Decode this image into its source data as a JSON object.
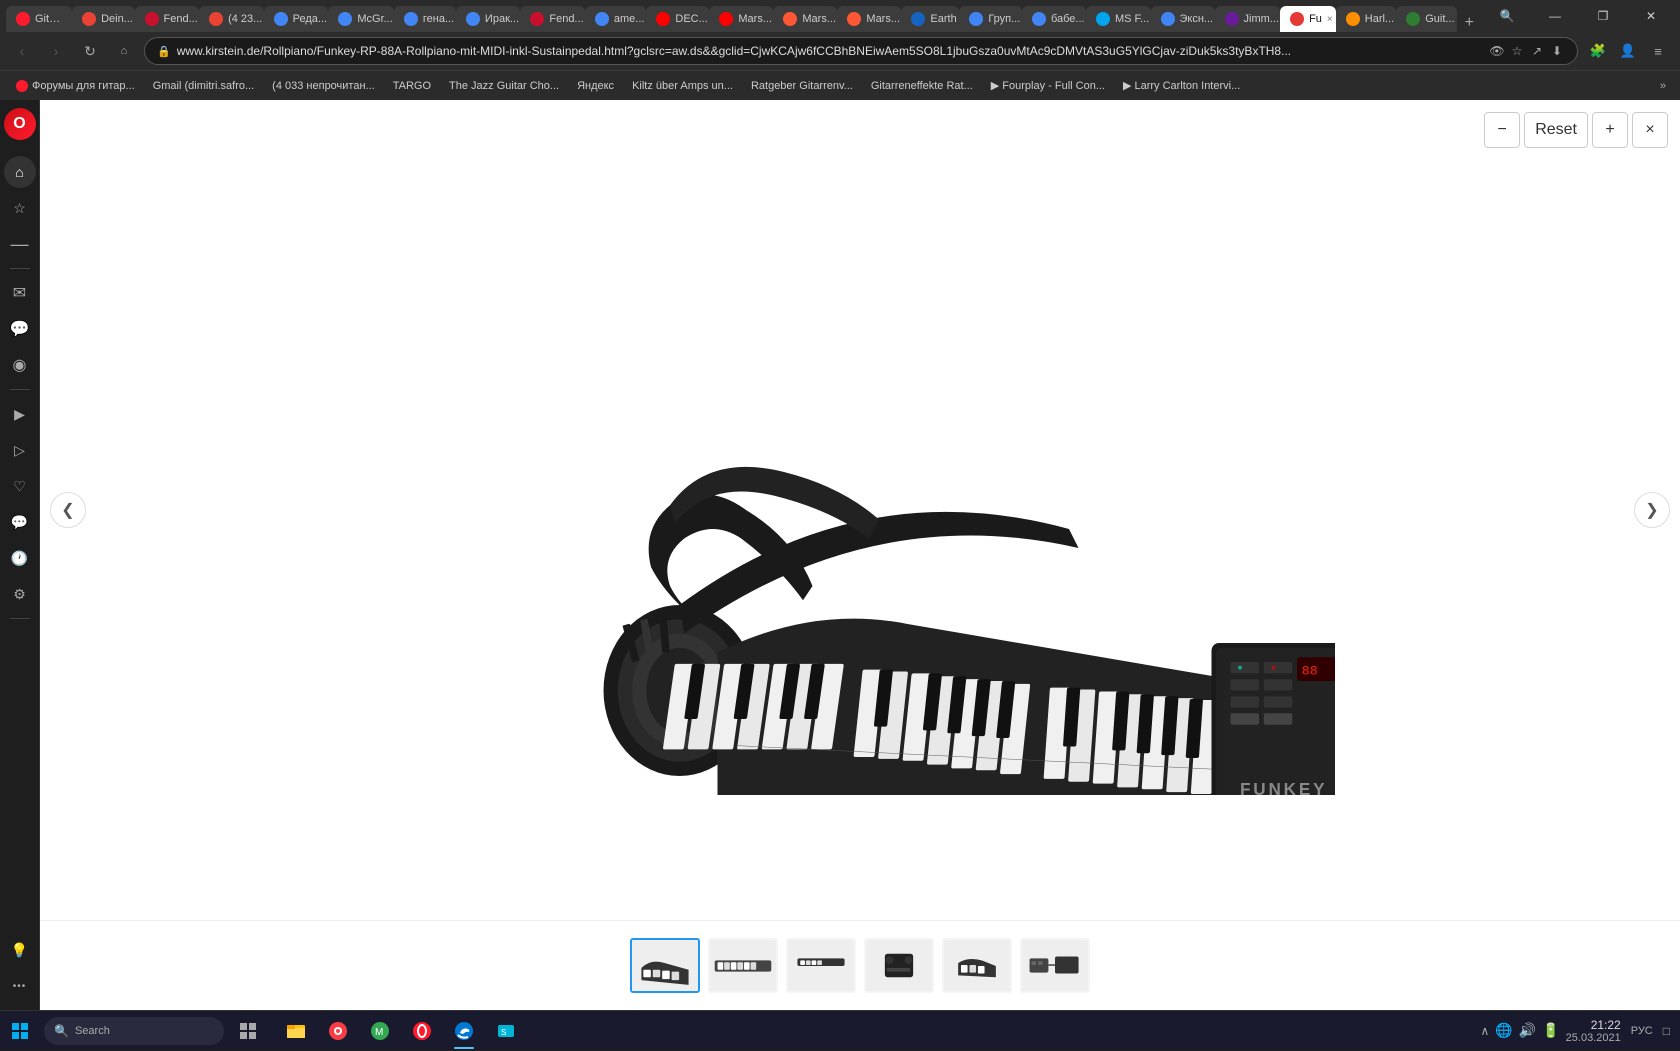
{
  "browser": {
    "title": "Funkey RP-88A Rollpiano",
    "tabs": [
      {
        "id": "t1",
        "label": "Gitarr...",
        "fav": "opera",
        "active": false
      },
      {
        "id": "t2",
        "label": "Dein...",
        "fav": "gmail",
        "active": false
      },
      {
        "id": "t3",
        "label": "Fend...",
        "fav": "fender",
        "active": false
      },
      {
        "id": "t4",
        "label": "(4 23...",
        "fav": "gmail",
        "active": false
      },
      {
        "id": "t5",
        "label": "Реда...",
        "fav": "blue",
        "active": false
      },
      {
        "id": "t6",
        "label": "McGr...",
        "fav": "blue",
        "active": false
      },
      {
        "id": "t7",
        "label": "гена...",
        "fav": "blue",
        "active": false
      },
      {
        "id": "t8",
        "label": "Ирак...",
        "fav": "blue",
        "active": false
      },
      {
        "id": "t9",
        "label": "Fend...",
        "fav": "fender",
        "active": false
      },
      {
        "id": "t10",
        "label": "ame...",
        "fav": "blue",
        "active": false
      },
      {
        "id": "t11",
        "label": "DEC...",
        "fav": "youtube",
        "active": false
      },
      {
        "id": "t12",
        "label": "Mars...",
        "fav": "youtube",
        "active": false
      },
      {
        "id": "t13",
        "label": "Mars...",
        "fav": "mars",
        "active": false
      },
      {
        "id": "t14",
        "label": "Mars...",
        "fav": "mars",
        "active": false
      },
      {
        "id": "t15",
        "label": "Earth",
        "fav": "earth",
        "active": false
      },
      {
        "id": "t16",
        "label": "Груп...",
        "fav": "blue",
        "active": false
      },
      {
        "id": "t17",
        "label": "бабе...",
        "fav": "blue",
        "active": false
      },
      {
        "id": "t18",
        "label": "MS F...",
        "fav": "ms",
        "active": false
      },
      {
        "id": "t19",
        "label": "Эксн...",
        "fav": "blue",
        "active": false
      },
      {
        "id": "t20",
        "label": "Jimm...",
        "fav": "jimmy",
        "active": false
      },
      {
        "id": "t21",
        "label": "Fu ×",
        "fav": "fuji",
        "active": true
      },
      {
        "id": "t22",
        "label": "Harl...",
        "fav": "harley",
        "active": false
      },
      {
        "id": "t23",
        "label": "Guit...",
        "fav": "guitar",
        "active": false
      }
    ],
    "address_url": "www.kirstein.de/Rollpiano/Funkey-RP-88A-Rollpiano-mit-MIDI-inkl-Sustainpedal.html?gclsrc=aw.ds&&gclid=CjwKCAjw6fCCBhBNEiwAem5SO8L1jbuGsza0uvMtAc9cDMVtAS3uG5YlGCjav-ziDuk5ks3tyBxTH8...",
    "search_placeholder": "Search"
  },
  "bookmarks": [
    {
      "label": "Форумы для гитар...",
      "fav": "opera"
    },
    {
      "label": "Gmail (dimitri.safro..."
    },
    {
      "label": "(4 033 непрочитан..."
    },
    {
      "label": "TARGO"
    },
    {
      "label": "The Jazz Guitar Cho..."
    },
    {
      "label": "Яндекс"
    },
    {
      "label": "Kiltz über Amps un..."
    },
    {
      "label": "Ratgeber Gitarrenv..."
    },
    {
      "label": "Gitarreneffekte Rat..."
    },
    {
      "label": "Fourplay - Full Con..."
    },
    {
      "label": "Larry Carlton Intervi..."
    }
  ],
  "viewer": {
    "zoom_minus": "−",
    "zoom_reset": "Reset",
    "zoom_plus": "+",
    "close": "×",
    "nav_left": "❮",
    "nav_right": "❯"
  },
  "thumbnails": [
    {
      "id": "thumb1",
      "active": true
    },
    {
      "id": "thumb2",
      "active": false
    },
    {
      "id": "thumb3",
      "active": false
    },
    {
      "id": "thumb4",
      "active": false
    },
    {
      "id": "thumb5",
      "active": false
    },
    {
      "id": "thumb6",
      "active": false
    }
  ],
  "sidebar": {
    "items": [
      {
        "name": "opera-logo",
        "icon": "O"
      },
      {
        "name": "start-page",
        "icon": "⌂"
      },
      {
        "name": "bookmarks",
        "icon": "☆"
      },
      {
        "name": "history",
        "icon": "—"
      },
      {
        "name": "messenger",
        "icon": "✉"
      },
      {
        "name": "whatsapp",
        "icon": "📱"
      },
      {
        "name": "instagram",
        "icon": "◉"
      },
      {
        "name": "separator1",
        "divider": true
      },
      {
        "name": "video",
        "icon": "▶"
      },
      {
        "name": "player",
        "icon": "▷"
      },
      {
        "name": "heart",
        "icon": "♡"
      },
      {
        "name": "chat",
        "icon": "💬"
      },
      {
        "name": "clock",
        "icon": "🕐"
      },
      {
        "name": "settings",
        "icon": "⚙"
      },
      {
        "name": "separator2",
        "divider": true
      },
      {
        "name": "bulb",
        "icon": "💡"
      },
      {
        "name": "more",
        "icon": "•••"
      }
    ]
  },
  "taskbar": {
    "time": "21:22",
    "date": "25.03.2021",
    "language": "РУС",
    "tray_icons": [
      "🔊",
      "🌐",
      "⌂"
    ]
  }
}
